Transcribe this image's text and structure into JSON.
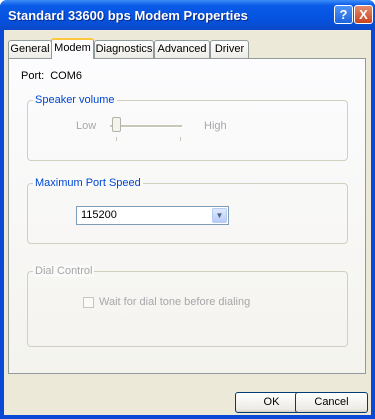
{
  "window": {
    "title": "Standard 33600 bps Modem Properties",
    "help_label": "?",
    "close_label": "X"
  },
  "tabs": [
    {
      "label": "General"
    },
    {
      "label": "Modem",
      "active": true
    },
    {
      "label": "Diagnostics"
    },
    {
      "label": "Advanced"
    },
    {
      "label": "Driver"
    }
  ],
  "port": {
    "label": "Port:",
    "value": "COM6"
  },
  "speaker": {
    "legend": "Speaker volume",
    "low_label": "Low",
    "high_label": "High",
    "level": 0.0,
    "enabled": false
  },
  "max_speed": {
    "legend": "Maximum Port Speed",
    "selected": "115200"
  },
  "dial": {
    "legend": "Dial Control",
    "checkbox_label": "Wait for dial tone before dialing",
    "checked": false,
    "enabled": false
  },
  "buttons": {
    "ok": "OK",
    "cancel": "Cancel"
  },
  "colors": {
    "title_bar": "#0553e0",
    "face": "#ece9d8",
    "group_title": "#0046d5",
    "disabled_text": "#a7a6aa"
  }
}
